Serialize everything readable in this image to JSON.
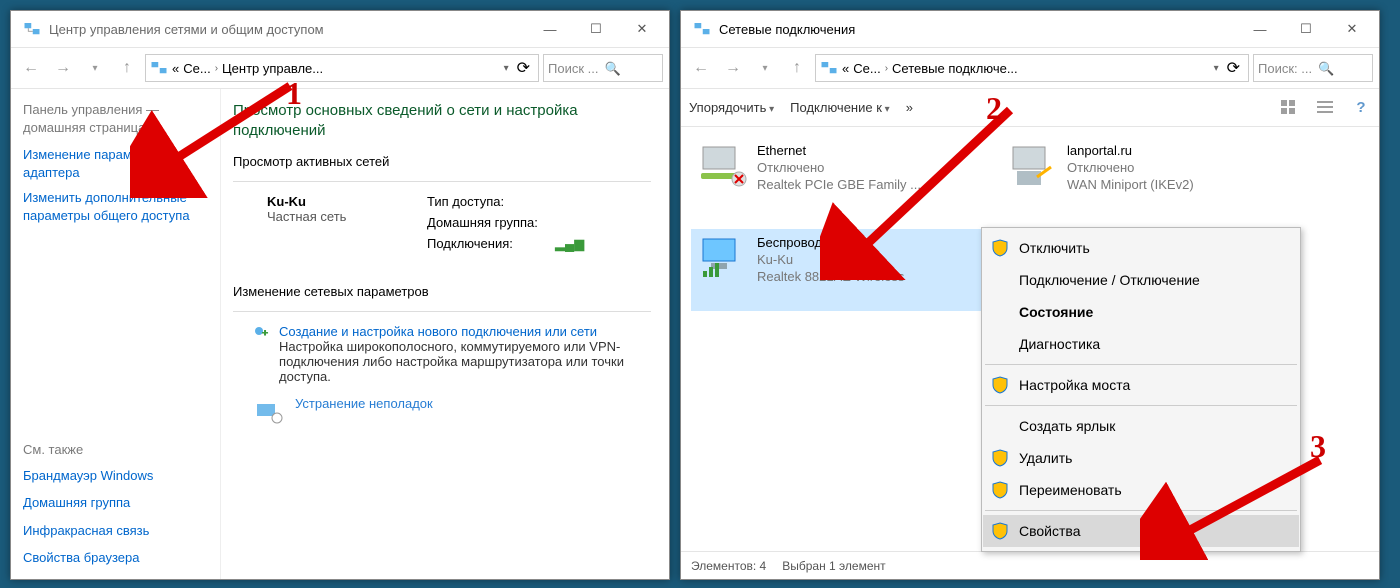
{
  "left": {
    "title": "Центр управления сетями и общим доступом",
    "breadcrumb": {
      "root": "«",
      "seg1": "Се...",
      "seg2": "Центр управле..."
    },
    "search_placeholder": "Поиск ...",
    "sidebar": {
      "home": "Панель управления — домашняя страница",
      "links": [
        "Изменение параметров адаптера",
        "Изменить дополнительные параметры общего доступа"
      ],
      "also_label": "См. также",
      "also": [
        "Брандмауэр Windows",
        "Домашняя группа",
        "Инфракрасная связь",
        "Свойства браузера"
      ]
    },
    "heading": "Просмотр основных сведений о сети и настройка подключений",
    "active_label": "Просмотр активных сетей",
    "network": {
      "name": "Ku-Ku",
      "type": "Частная сеть"
    },
    "kv": {
      "access": "Тип доступа:",
      "homegroup": "Домашняя группа:",
      "connections": "Подключения:"
    },
    "change_label": "Изменение сетевых параметров",
    "setup": {
      "title": "Создание и настройка нового подключения или сети",
      "desc": "Настройка широкополосного, коммутируемого или VPN-подключения либо настройка маршрутизатора или точки доступа."
    },
    "troubleshoot": {
      "title": "Устранение неполадок"
    }
  },
  "right": {
    "title": "Сетевые подключения",
    "breadcrumb": {
      "root": "«",
      "seg1": "Се...",
      "seg2": "Сетевые подключе..."
    },
    "search_placeholder": "Поиск: ...",
    "toolbar": {
      "organize": "Упорядочить",
      "connect": "Подключение к",
      "more": "»"
    },
    "connections": [
      {
        "name": "Ethernet",
        "status": "Отключено",
        "device": "Realtek PCIe GBE Family ..."
      },
      {
        "name": "lanportal.ru",
        "status": "Отключено",
        "device": "WAN Miniport (IKEv2)"
      },
      {
        "name": "Беспроводная сеть",
        "status": "Ku-Ku",
        "device": "Realtek 8821AE Wireless",
        "selected": true
      }
    ],
    "context_menu": [
      {
        "label": "Отключить",
        "shield": true
      },
      {
        "label": "Подключение / Отключение"
      },
      {
        "label": "Состояние",
        "bold": true
      },
      {
        "label": "Диагностика"
      },
      {
        "sep": true
      },
      {
        "label": "Настройка моста",
        "shield": true
      },
      {
        "sep": true
      },
      {
        "label": "Создать ярлык"
      },
      {
        "label": "Удалить",
        "shield": true
      },
      {
        "label": "Переименовать",
        "shield": true
      },
      {
        "sep": true
      },
      {
        "label": "Свойства",
        "shield": true,
        "hover": true
      }
    ],
    "status": {
      "elements": "Элементов: 4",
      "selected": "Выбран 1 элемент"
    }
  },
  "annotations": {
    "a1": "1",
    "a2": "2",
    "a3": "3"
  }
}
